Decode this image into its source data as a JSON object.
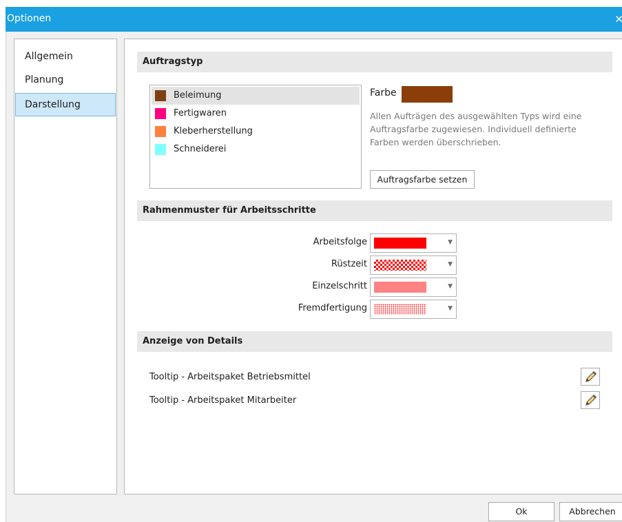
{
  "window": {
    "title": "Optionen",
    "close_glyph": "✕"
  },
  "sidebar": {
    "items": [
      {
        "label": "Allgemein"
      },
      {
        "label": "Planung"
      },
      {
        "label": "Darstellung",
        "active": true
      }
    ]
  },
  "auftragstyp": {
    "header": "Auftragstyp",
    "types": [
      {
        "label": "Beleimung",
        "color": "#7f3f12",
        "selected": true
      },
      {
        "label": "Fertigwaren",
        "color": "#ff0080"
      },
      {
        "label": "Kleberherstellung",
        "color": "#ff8040"
      },
      {
        "label": "Schneiderei",
        "color": "#80ffff"
      }
    ],
    "farbe_label": "Farbe",
    "farbe_color": "#8b3e0a",
    "description": "Allen Aufträgen des ausgewählten Typs wird eine Auftragsfarbe zugewiesen. Individuell definierte Farben werden überschrieben.",
    "set_button": "Auftragsfarbe setzen"
  },
  "rahmenmuster": {
    "header": "Rahmenmuster für Arbeitsschritte",
    "rows": [
      {
        "label": "Arbeitsfolge",
        "pattern": "solid-red"
      },
      {
        "label": "Rüstzeit",
        "pattern": "checkered-red"
      },
      {
        "label": "Einzelschritt",
        "pattern": "dense-dotted-red"
      },
      {
        "label": "Fremdfertigung",
        "pattern": "sparse-dotted-red"
      }
    ]
  },
  "details": {
    "header": "Anzeige von Details",
    "rows": [
      {
        "label": "Tooltip - Arbeitspaket Betriebsmittel",
        "icon": "pencil-icon"
      },
      {
        "label": "Tooltip - Arbeitspaket Mitarbeiter",
        "icon": "pencil-icon"
      }
    ]
  },
  "footer": {
    "ok_label": "Ok",
    "cancel_label": "Abbrechen"
  },
  "colors": {
    "titlebar": "#1ba1e2",
    "accent_selected": "#cde8f8"
  }
}
